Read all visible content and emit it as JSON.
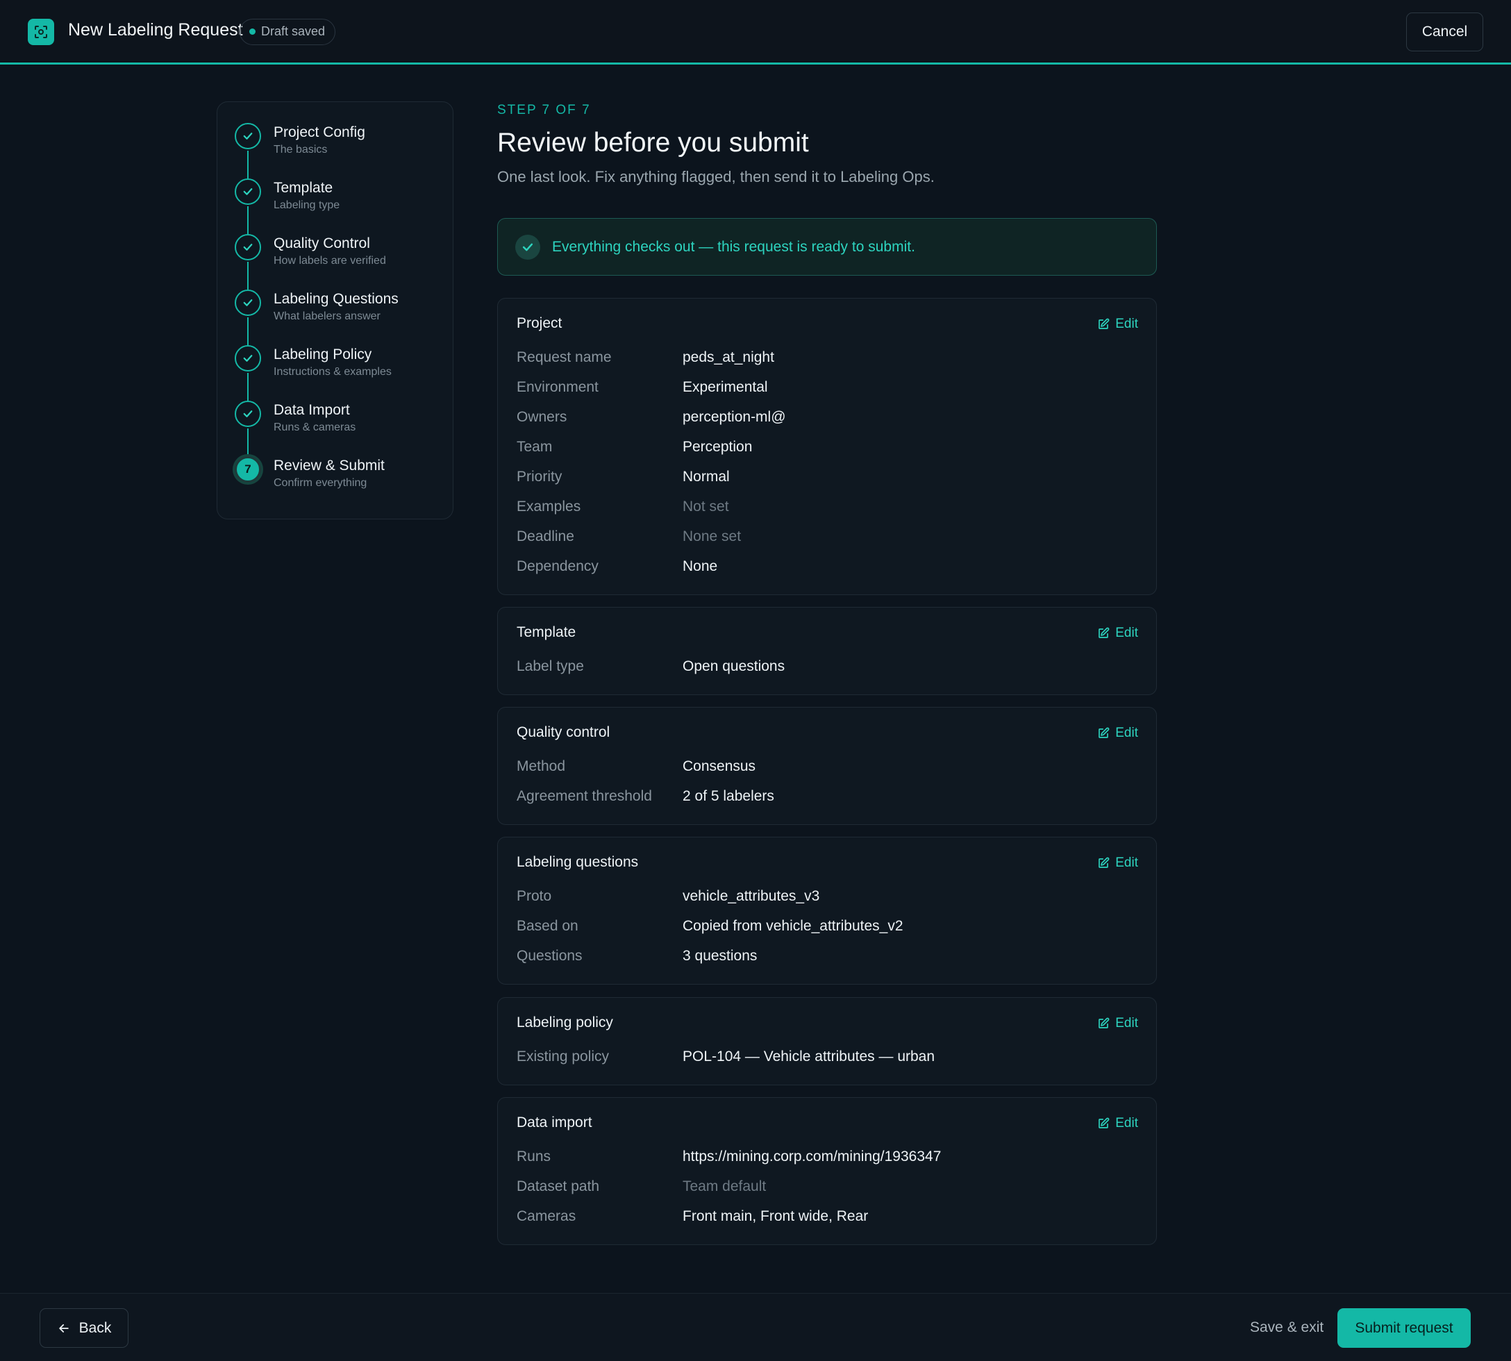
{
  "header": {
    "title": "New Labeling Request",
    "draft_badge": "Draft saved",
    "cancel_label": "Cancel",
    "accent_color": "#14b8a6"
  },
  "stepper": {
    "steps": [
      {
        "title": "Project Config",
        "subtitle": "The basics",
        "status": "complete"
      },
      {
        "title": "Template",
        "subtitle": "Labeling type",
        "status": "complete"
      },
      {
        "title": "Quality Control",
        "subtitle": "How labels are verified",
        "status": "complete"
      },
      {
        "title": "Labeling Questions",
        "subtitle": "What labelers answer",
        "status": "complete"
      },
      {
        "title": "Labeling Policy",
        "subtitle": "Instructions & examples",
        "status": "complete"
      },
      {
        "title": "Data Import",
        "subtitle": "Runs & cameras",
        "status": "complete"
      },
      {
        "title": "Review & Submit",
        "subtitle": "Confirm everything",
        "status": "current",
        "number": "7"
      }
    ]
  },
  "main": {
    "step_label": "STEP 7 OF 7",
    "title": "Review before you submit",
    "subtitle": "One last look. Fix anything flagged, then send it to Labeling Ops.",
    "banner": "Everything checks out — this request is ready to submit.",
    "edit_label": "Edit",
    "sections": [
      {
        "title": "Project",
        "rows": [
          {
            "label": "Request name",
            "value": "peds_at_night"
          },
          {
            "label": "Environment",
            "value": "Experimental"
          },
          {
            "label": "Owners",
            "value": "perception-ml@"
          },
          {
            "label": "Team",
            "value": "Perception"
          },
          {
            "label": "Priority",
            "value": "Normal"
          },
          {
            "label": "Examples",
            "value": "Not set",
            "muted": true
          },
          {
            "label": "Deadline",
            "value": "None set",
            "muted": true
          },
          {
            "label": "Dependency",
            "value": "None"
          }
        ]
      },
      {
        "title": "Template",
        "rows": [
          {
            "label": "Label type",
            "value": "Open questions"
          }
        ]
      },
      {
        "title": "Quality control",
        "rows": [
          {
            "label": "Method",
            "value": "Consensus"
          },
          {
            "label": "Agreement threshold",
            "value": "2 of 5 labelers"
          }
        ]
      },
      {
        "title": "Labeling questions",
        "rows": [
          {
            "label": "Proto",
            "value": "vehicle_attributes_v3"
          },
          {
            "label": "Based on",
            "value": "Copied from vehicle_attributes_v2"
          },
          {
            "label": "Questions",
            "value": "3 questions"
          }
        ]
      },
      {
        "title": "Labeling policy",
        "rows": [
          {
            "label": "Existing policy",
            "value": "POL-104 — Vehicle attributes — urban"
          }
        ]
      },
      {
        "title": "Data import",
        "rows": [
          {
            "label": "Runs",
            "value": "https://mining.corp.com/mining/1936347"
          },
          {
            "label": "Dataset path",
            "value": "Team default",
            "muted": true
          },
          {
            "label": "Cameras",
            "value": "Front main, Front wide, Rear"
          }
        ]
      }
    ]
  },
  "footer": {
    "back_label": "Back",
    "save_exit_label": "Save & exit",
    "submit_label": "Submit request"
  }
}
